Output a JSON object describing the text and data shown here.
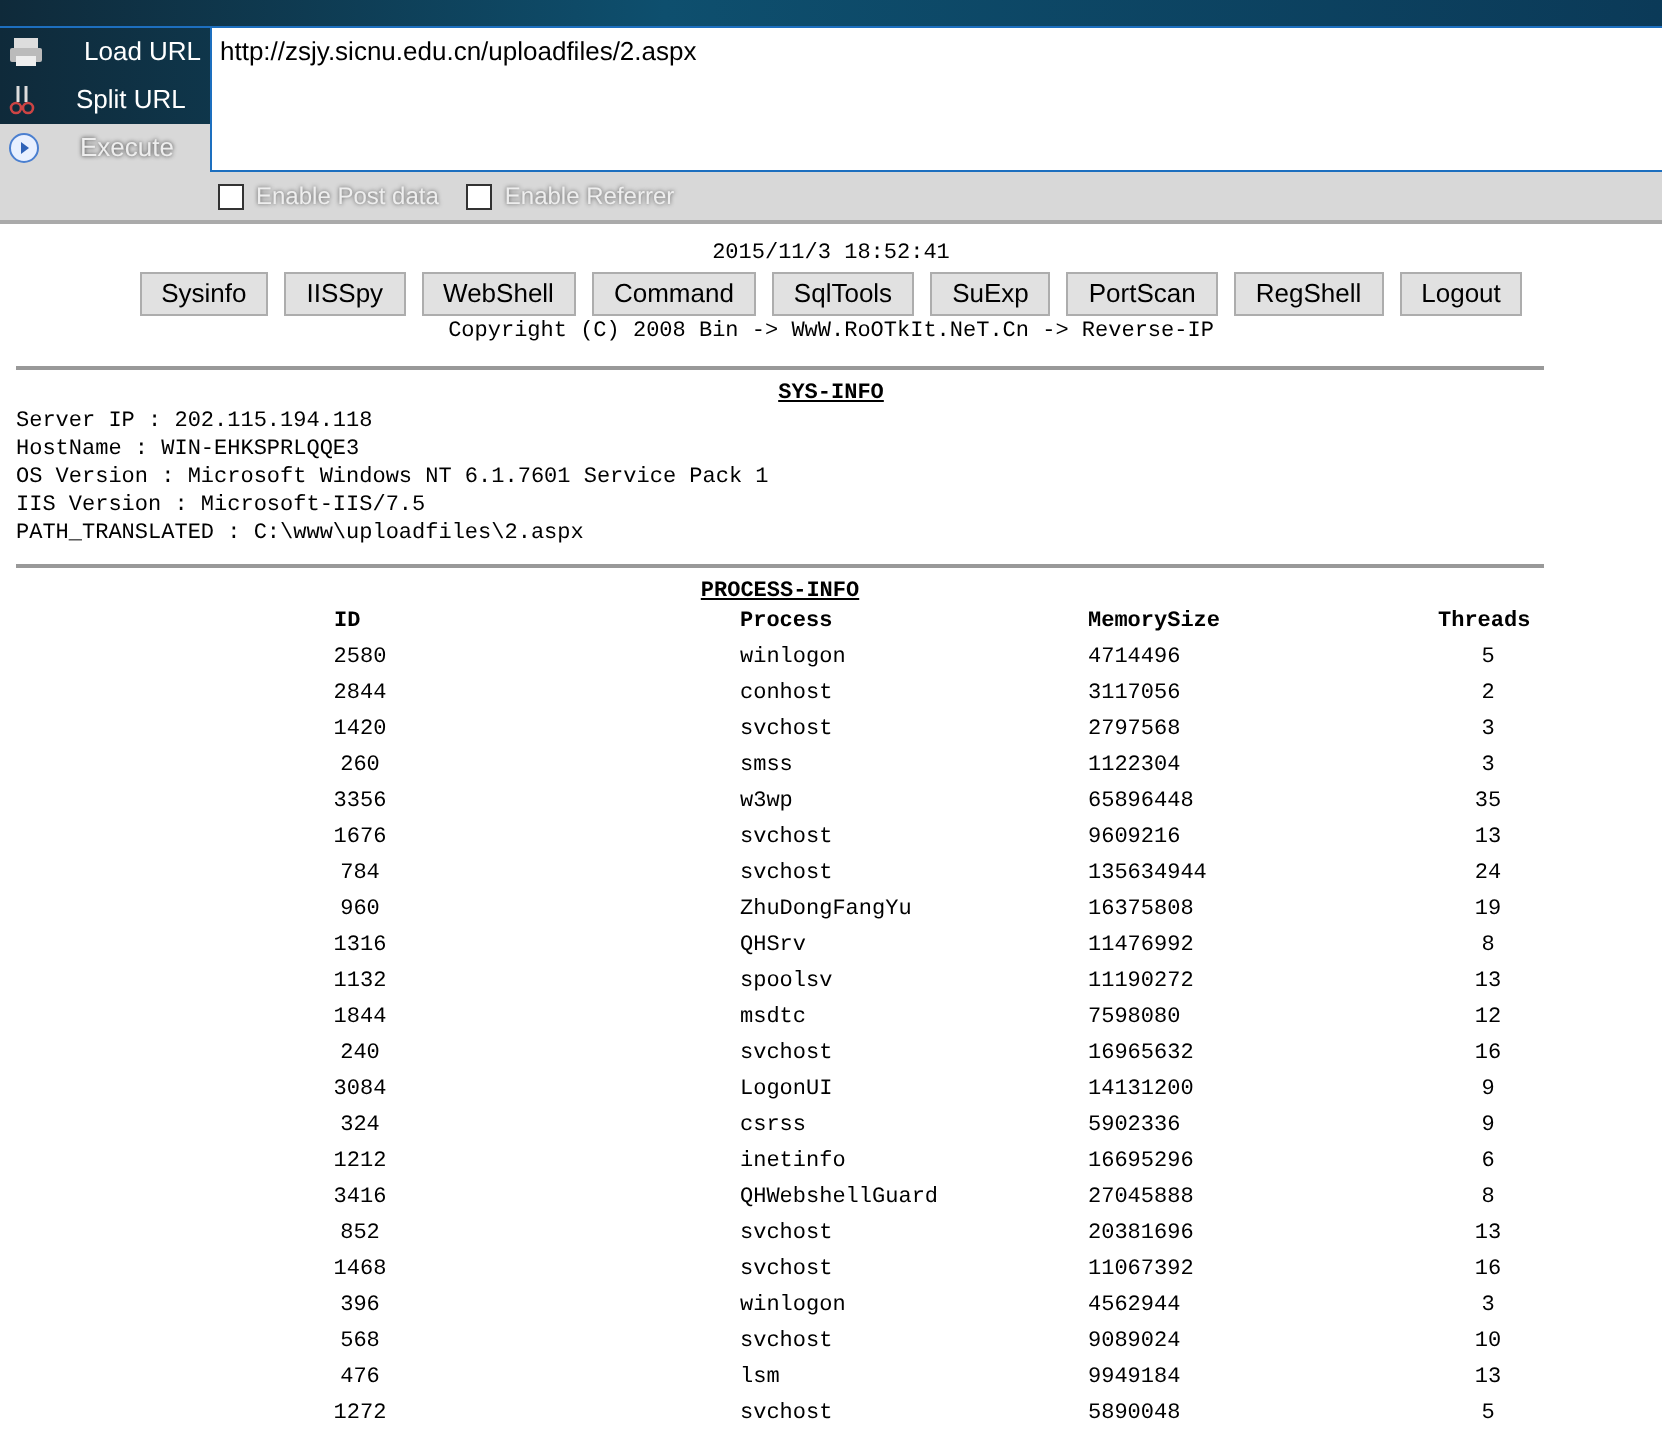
{
  "toolbar": {
    "actions": [
      {
        "label": "Load URL",
        "kind": "load"
      },
      {
        "label": "Split URL",
        "kind": "split"
      },
      {
        "label": "Execute",
        "kind": "execute"
      }
    ],
    "url": "http://zsjy.sicnu.edu.cn/uploadfiles/2.aspx",
    "options": [
      {
        "label": "Enable Post data",
        "checked": false
      },
      {
        "label": "Enable Referrer",
        "checked": false
      }
    ]
  },
  "page": {
    "datetime": "2015/11/3 18:52:41",
    "buttons": [
      "Sysinfo",
      "IISSpy",
      "WebShell",
      "Command",
      "SqlTools",
      "SuExp",
      "PortScan",
      "RegShell",
      "Logout"
    ],
    "copyright": "Copyright (C) 2008 Bin -> WwW.RoOTkIt.NeT.Cn -> Reverse-IP",
    "sys_info": {
      "title": "SYS-INFO",
      "lines": [
        "Server IP : 202.115.194.118",
        "HostName : WIN-EHKSPRLQQE3",
        "OS Version : Microsoft Windows NT 6.1.7601 Service Pack 1",
        "IIS Version : Microsoft-IIS/7.5",
        "PATH_TRANSLATED : C:\\www\\uploadfiles\\2.aspx"
      ]
    },
    "process_info": {
      "title": "PROCESS-INFO",
      "columns": [
        "ID",
        "Process",
        "MemorySize",
        "Threads"
      ],
      "rows": [
        [
          "2580",
          "winlogon",
          "4714496",
          "5"
        ],
        [
          "2844",
          "conhost",
          "3117056",
          "2"
        ],
        [
          "1420",
          "svchost",
          "2797568",
          "3"
        ],
        [
          "260",
          "smss",
          "1122304",
          "3"
        ],
        [
          "3356",
          "w3wp",
          "65896448",
          "35"
        ],
        [
          "1676",
          "svchost",
          "9609216",
          "13"
        ],
        [
          "784",
          "svchost",
          "135634944",
          "24"
        ],
        [
          "960",
          "ZhuDongFangYu",
          "16375808",
          "19"
        ],
        [
          "1316",
          "QHSrv",
          "11476992",
          "8"
        ],
        [
          "1132",
          "spoolsv",
          "11190272",
          "13"
        ],
        [
          "1844",
          "msdtc",
          "7598080",
          "12"
        ],
        [
          "240",
          "svchost",
          "16965632",
          "16"
        ],
        [
          "3084",
          "LogonUI",
          "14131200",
          "9"
        ],
        [
          "324",
          "csrss",
          "5902336",
          "9"
        ],
        [
          "1212",
          "inetinfo",
          "16695296",
          "6"
        ],
        [
          "3416",
          "QHWebshellGuard",
          "27045888",
          "8"
        ],
        [
          "852",
          "svchost",
          "20381696",
          "13"
        ],
        [
          "1468",
          "svchost",
          "11067392",
          "16"
        ],
        [
          "396",
          "winlogon",
          "4562944",
          "3"
        ],
        [
          "568",
          "svchost",
          "9089024",
          "10"
        ],
        [
          "476",
          "lsm",
          "9949184",
          "13"
        ],
        [
          "1272",
          "svchost",
          "5890048",
          "5"
        ]
      ]
    }
  }
}
